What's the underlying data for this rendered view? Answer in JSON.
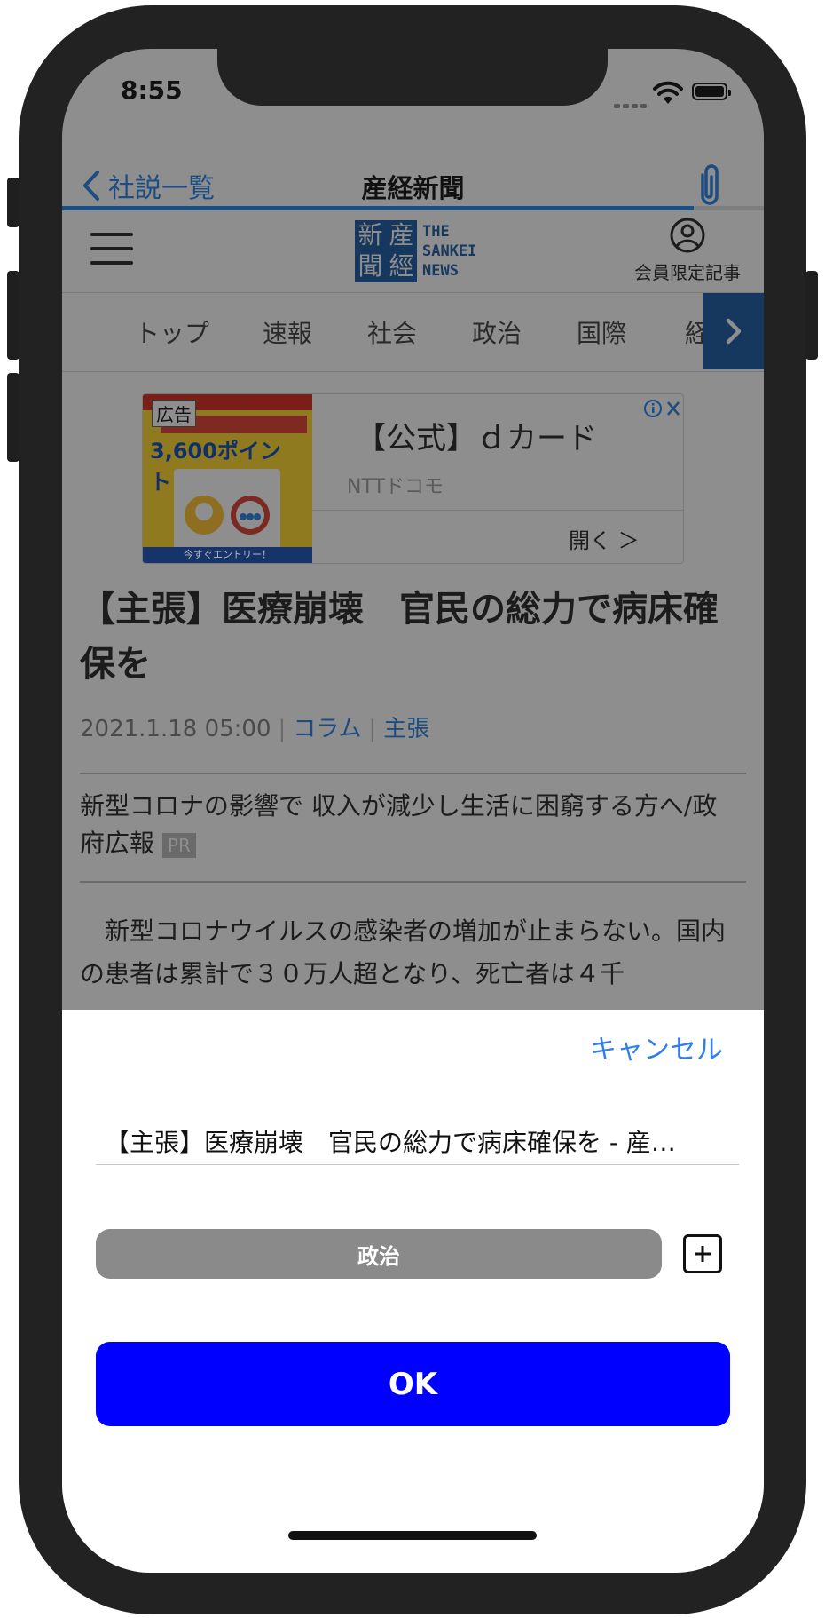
{
  "status_bar": {
    "time": "8:55"
  },
  "nav": {
    "back_label": "社説一覧",
    "title": "産経新聞"
  },
  "site_header": {
    "logo_kanji": [
      "新",
      "産",
      "聞",
      "經"
    ],
    "logo_text": [
      "THE",
      "SANKEI",
      "NEWS"
    ],
    "member_label": "会員限定記事"
  },
  "tabs": [
    "トップ",
    "速報",
    "社会",
    "政治",
    "国際",
    "経"
  ],
  "ad": {
    "badge": "広告",
    "brand": "docomo",
    "points": "3,600ポイント!",
    "footer": "今すぐエントリー！",
    "title": "【公式】ｄカード",
    "advertiser": "NTTドコモ",
    "open_label": "開く ＞"
  },
  "article": {
    "headline": "【主張】医療崩壊　官民の総力で病床確保を",
    "date": "2021.1.18 05:00",
    "category_column": "コラム",
    "category_opinion": "主張",
    "pr_text": "新型コロナの影響で 収入が減少し生活に困窮する方へ/政府広報",
    "pr_badge": "PR",
    "body": "新型コロナウイルスの感染者の増加が止まらない。国内の患者は累計で３０万人超となり、死亡者は４千"
  },
  "sheet": {
    "cancel_label": "キャンセル",
    "title_value": "【主張】医療崩壊　官民の総力で病床確保を - 産…",
    "category_label": "政治",
    "ok_label": "OK"
  },
  "colors": {
    "ok_button": "#0000ff",
    "cancel_link": "#2f7ef0",
    "category_chip": "#8a8a8a"
  }
}
